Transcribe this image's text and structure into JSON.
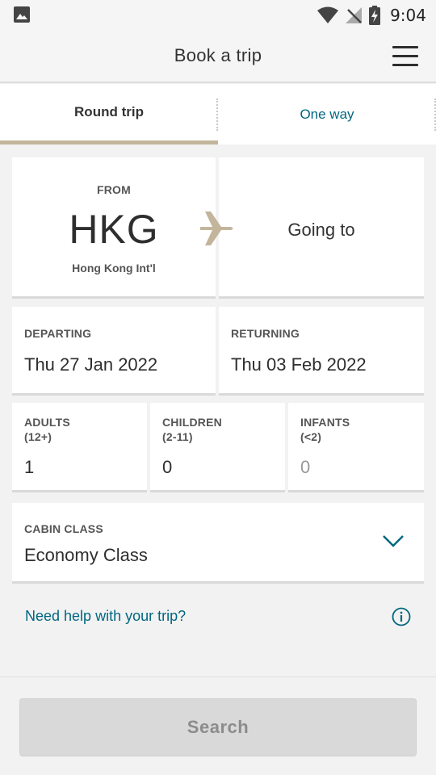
{
  "status_bar": {
    "time": "9:04"
  },
  "header": {
    "title": "Book a trip"
  },
  "tabs": [
    {
      "label": "Round trip",
      "selected": true
    },
    {
      "label": "One way",
      "selected": false
    }
  ],
  "route": {
    "from_label": "FROM",
    "from_code": "HKG",
    "from_airport": "Hong Kong Int'l",
    "to_placeholder": "Going to"
  },
  "dates": {
    "departing_label": "DEPARTING",
    "departing_value": "Thu 27 Jan 2022",
    "returning_label": "RETURNING",
    "returning_value": "Thu 03 Feb 2022"
  },
  "passengers": {
    "adults": {
      "label": "ADULTS",
      "sublabel": "(12+)",
      "value": "1"
    },
    "children": {
      "label": "CHILDREN",
      "sublabel": "(2-11)",
      "value": "0"
    },
    "infants": {
      "label": "INFANTS",
      "sublabel": "(<2)",
      "value": "0"
    }
  },
  "cabin": {
    "label": "CABIN CLASS",
    "value": "Economy Class"
  },
  "help": {
    "link": "Need help with your trip?"
  },
  "search": {
    "label": "Search"
  },
  "colors": {
    "accent": "#00677f",
    "tab_underline": "#c2b59c",
    "plane": "#c2b59c",
    "disabled_button": "#d9d9d9"
  }
}
